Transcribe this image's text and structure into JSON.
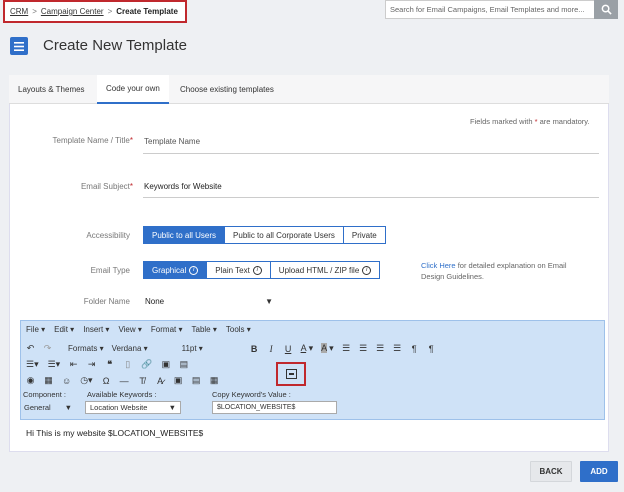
{
  "breadcrumb": {
    "items": [
      "CRM",
      "Campaign Center"
    ],
    "separator": ">",
    "current": "Create Template"
  },
  "search": {
    "placeholder": "Search for Email Campaigns, Email Templates and more...",
    "icon": "search-icon"
  },
  "header": {
    "title": "Create New Template",
    "menu_icon": "hamburger-icon"
  },
  "tabs": [
    {
      "label": "Layouts & Themes",
      "active": false
    },
    {
      "label": "Code your own",
      "active": true
    },
    {
      "label": "Choose existing templates",
      "active": false
    }
  ],
  "form": {
    "mandatory_note_prefix": "Fields marked with",
    "mandatory_star": "*",
    "mandatory_note_suffix": "are mandatory.",
    "name_label": "Template Name / Title",
    "name_value": "Template Name",
    "subject_label": "Email Subject",
    "subject_value": "Keywords for Website",
    "accessibility_label": "Accessibility",
    "accessibility_options": [
      "Public to all Users",
      "Public to all Corporate Users",
      "Private"
    ],
    "accessibility_selected": "Public to all Users",
    "email_type_label": "Email Type",
    "email_type_options": [
      "Graphical",
      "Plain Text",
      "Upload HTML / ZIP file"
    ],
    "email_type_selected": "Graphical",
    "click_here": "Click Here",
    "click_here_text": "for detailed explanation on Email Design Guidelines.",
    "folder_label": "Folder Name",
    "folder_value": "None"
  },
  "editor": {
    "menus": [
      "File",
      "Edit",
      "Insert",
      "View",
      "Format",
      "Table",
      "Tools"
    ],
    "formats_label": "Formats",
    "font_family": "Verdana",
    "font_size": "11pt",
    "component_label": "Component :",
    "component_value": "General",
    "keywords_label": "Available Keywords :",
    "keywords_value": "Location Website",
    "copy_label": "Copy Keyword's Value :",
    "copy_value": "$LOCATION_WEBSITE$",
    "body_text": "Hi This is my website  $LOCATION_WEBSITE$"
  },
  "actions": {
    "back": "BACK",
    "add": "ADD"
  },
  "colors": {
    "accent": "#2f6fc9",
    "highlight": "#c0282d",
    "editor_bg": "#cfe2f7"
  }
}
